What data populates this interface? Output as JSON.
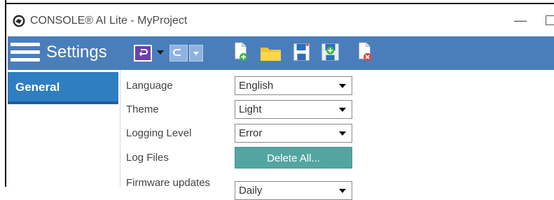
{
  "window": {
    "title": "CONSOLE® AI Lite - MyProject",
    "minimize_glyph": "—"
  },
  "header": {
    "title": "Settings",
    "accent_color": "#4a7ebb"
  },
  "toolbar": {
    "icons": [
      "undo-icon",
      "redo-icon",
      "new-document-icon",
      "open-folder-icon",
      "save-icon",
      "add-icon",
      "close-document-icon"
    ]
  },
  "sidebar": {
    "items": [
      {
        "label": "General",
        "selected": true
      }
    ]
  },
  "settings": {
    "language": {
      "label": "Language",
      "value": "English"
    },
    "theme": {
      "label": "Theme",
      "value": "Light"
    },
    "logging_level": {
      "label": "Logging Level",
      "value": "Error"
    },
    "log_files": {
      "label": "Log Files",
      "button": "Delete All..."
    },
    "firmware_updates": {
      "label": "Firmware updates",
      "value": "Daily"
    }
  }
}
